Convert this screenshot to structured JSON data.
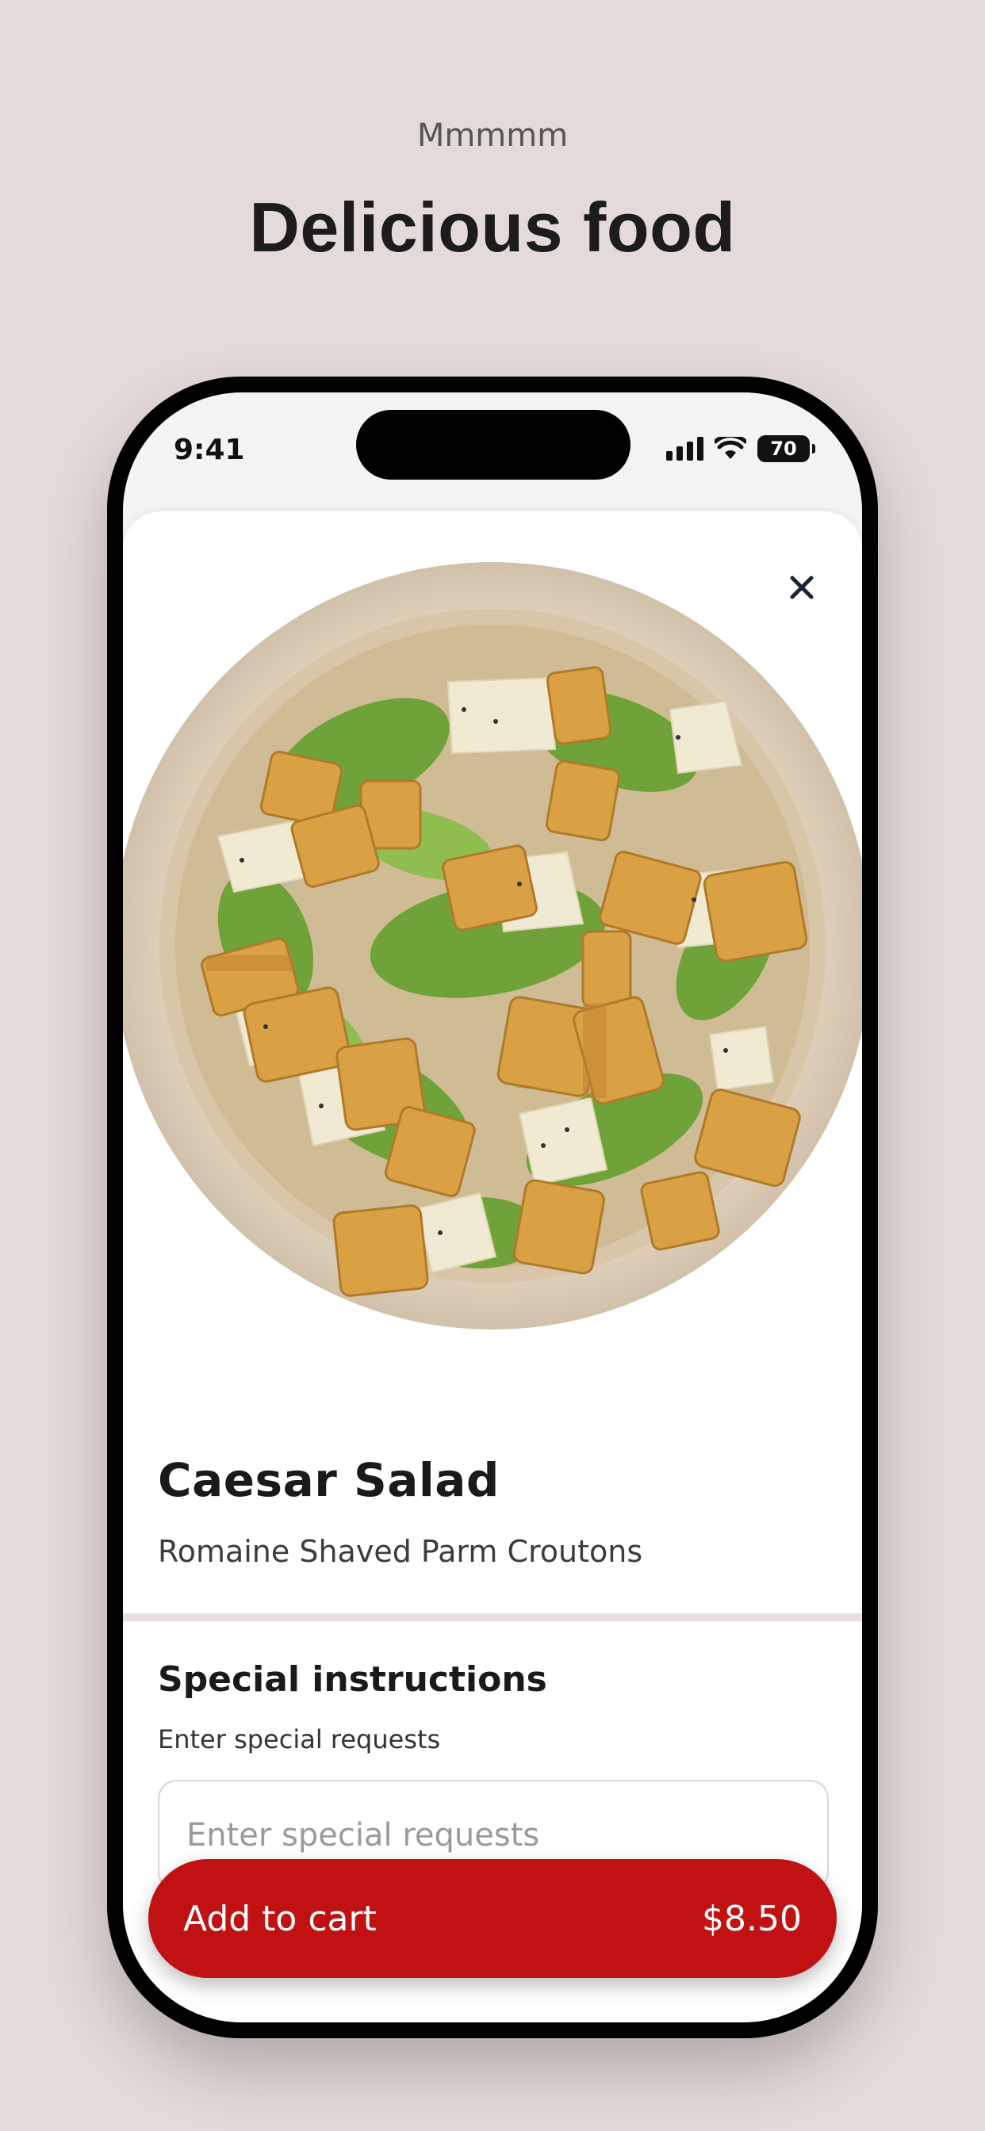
{
  "hero": {
    "kicker": "Mmmmm",
    "title": "Delicious food"
  },
  "status_bar": {
    "time": "9:41",
    "battery": "70",
    "icons": [
      "cellular-signal-icon",
      "wifi-icon",
      "battery-icon"
    ]
  },
  "product": {
    "image": "caesar-salad-bowl-photo",
    "name": "Caesar Salad",
    "description": "Romaine Shaved Parm Croutons",
    "close_icon": "close-icon"
  },
  "instructions": {
    "title": "Special instructions",
    "subtitle": "Enter special requests",
    "placeholder": "Enter special requests",
    "value": ""
  },
  "cart": {
    "label": "Add to cart",
    "price": "$8.50"
  },
  "colors": {
    "background": "#e4dad9",
    "accent": "#c01212",
    "text": "#1a1a1a"
  }
}
